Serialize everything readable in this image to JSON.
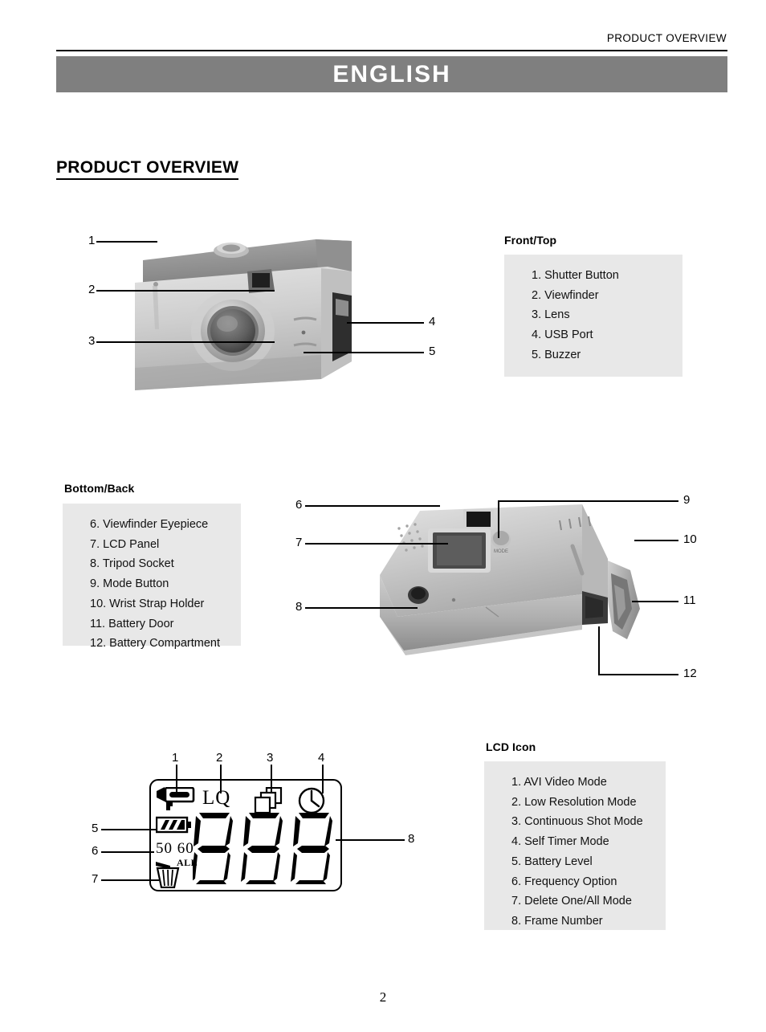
{
  "header": {
    "running_head": "PRODUCT OVERVIEW",
    "language_banner": "ENGLISH",
    "banner_color": "#7f7f7f"
  },
  "section": {
    "title": "PRODUCT OVERVIEW"
  },
  "front_top": {
    "heading": "Front/Top",
    "items": [
      "1. Shutter Button",
      "2. Viewfinder",
      "3. Lens",
      "4. USB Port",
      "5. Buzzer"
    ],
    "callouts": [
      "1",
      "2",
      "3",
      "4",
      "5"
    ]
  },
  "bottom_back": {
    "heading": "Bottom/Back",
    "items": [
      "6. Viewfinder Eyepiece",
      "7. LCD Panel",
      "8. Tripod Socket",
      "9. Mode Button",
      "10. Wrist Strap Holder",
      "11. Battery Door",
      "12. Battery Compartment"
    ],
    "callouts": [
      "6",
      "7",
      "8",
      "9",
      "10",
      "11",
      "12"
    ]
  },
  "lcd_icon": {
    "heading": "LCD Icon",
    "items": [
      "1. AVI Video Mode",
      "2. Low Resolution Mode",
      "3. Continuous Shot Mode",
      "4. Self Timer Mode",
      "5. Battery Level",
      "6. Frequency Option",
      "7. Delete One/All Mode",
      "8. Frame Number"
    ],
    "callouts": [
      "1",
      "2",
      "3",
      "4",
      "5",
      "6",
      "7",
      "8"
    ],
    "display": {
      "low_quality_label": "LQ",
      "frequency_label": "50 60",
      "delete_all_label": "ALL",
      "frame_number": "888",
      "icons": [
        "video-camera-icon",
        "stacked-frames-icon",
        "self-timer-clock-icon",
        "battery-level-icon",
        "trash-can-icon"
      ]
    }
  },
  "footer": {
    "page_number": "2"
  }
}
